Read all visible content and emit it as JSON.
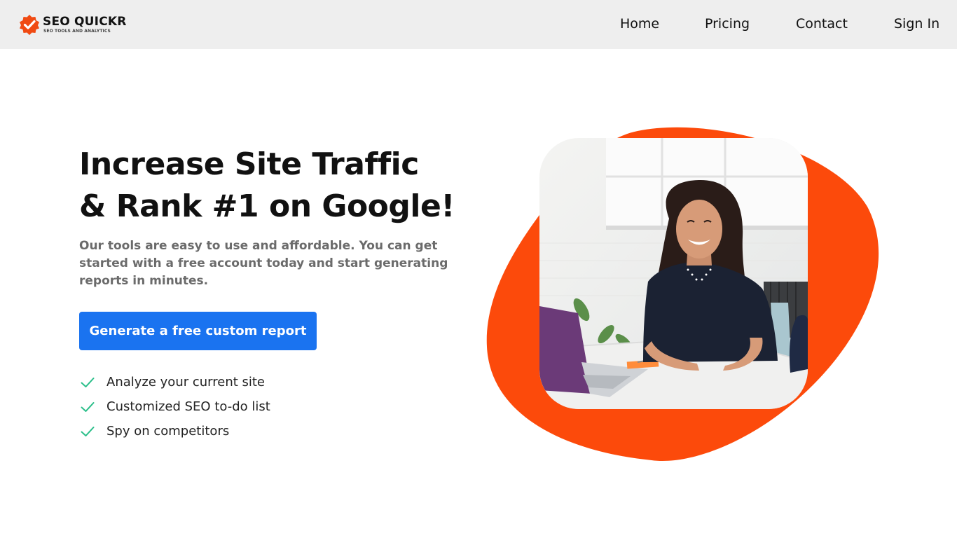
{
  "brand": {
    "name": "SEO QUICKR",
    "tagline": "SEO TOOLS AND ANALYTICS",
    "logo_icon": "checkmark-badge-icon",
    "accent_color": "#f04a12"
  },
  "nav": {
    "items": [
      {
        "label": "Home"
      },
      {
        "label": "Pricing"
      },
      {
        "label": "Contact"
      },
      {
        "label": "Sign In"
      }
    ]
  },
  "hero": {
    "headline_line1": "Increase Site Traffic",
    "headline_line2": "& Rank #1 on Google!",
    "subtext": "Our tools are easy to use and affordable. You can get started with a free account today and start generating reports in minutes.",
    "cta_label": "Generate a free custom report",
    "cta_color": "#1a73f0",
    "features": [
      {
        "label": "Analyze your current site",
        "icon": "check-icon"
      },
      {
        "label": "Customized SEO to-do list",
        "icon": "check-icon"
      },
      {
        "label": "Spy on competitors",
        "icon": "check-icon"
      }
    ],
    "check_color": "#2bbf8a",
    "blob_color": "#fc4a0b"
  }
}
